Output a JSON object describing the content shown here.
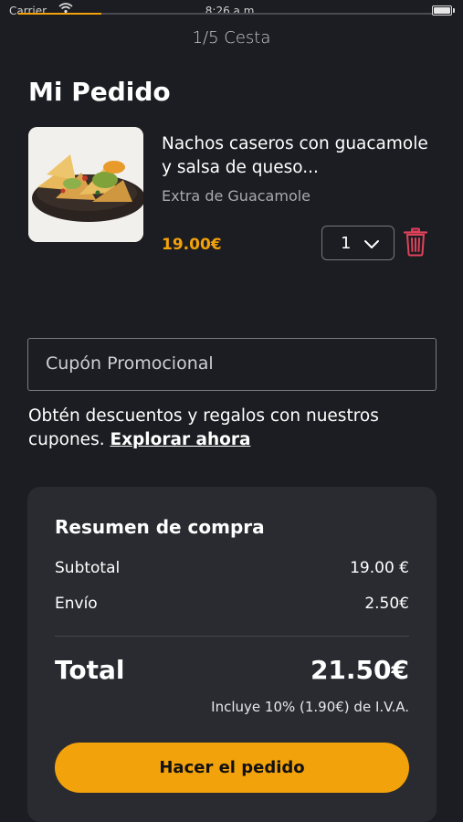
{
  "status_bar": {
    "carrier": "Carrier",
    "time": "8:26 a.m."
  },
  "header": {
    "progress": 0.2,
    "step_title": "1/5 Cesta"
  },
  "page": {
    "title": "Mi Pedido"
  },
  "cart": {
    "items": [
      {
        "name": "Nachos caseros con guacamole y salsa de queso...",
        "extra": "Extra de Guacamole",
        "price": "19.00€",
        "quantity": "1"
      }
    ]
  },
  "coupon": {
    "placeholder": "Cupón Promocional",
    "help_text": "Obtén descuentos y regalos con nuestros cupones.",
    "explore_link": "Explorar ahora"
  },
  "summary": {
    "title": "Resumen de compra",
    "subtotal_label": "Subtotal",
    "subtotal_value": "19.00 €",
    "shipping_label": "Envío",
    "shipping_value": "2.50€",
    "total_label": "Total",
    "total_value": "21.50€",
    "tax_note": "Incluye 10% (1.90€) de I.V.A.",
    "order_button": "Hacer el pedido"
  },
  "colors": {
    "background": "#1c1d22",
    "card": "#2a2b31",
    "accent": "#f2a20a",
    "delete": "#e0425a"
  },
  "icons": {
    "quantity": "chevron-down-icon",
    "delete": "trash-icon",
    "wifi": "wifi-icon",
    "battery": "battery-icon"
  }
}
